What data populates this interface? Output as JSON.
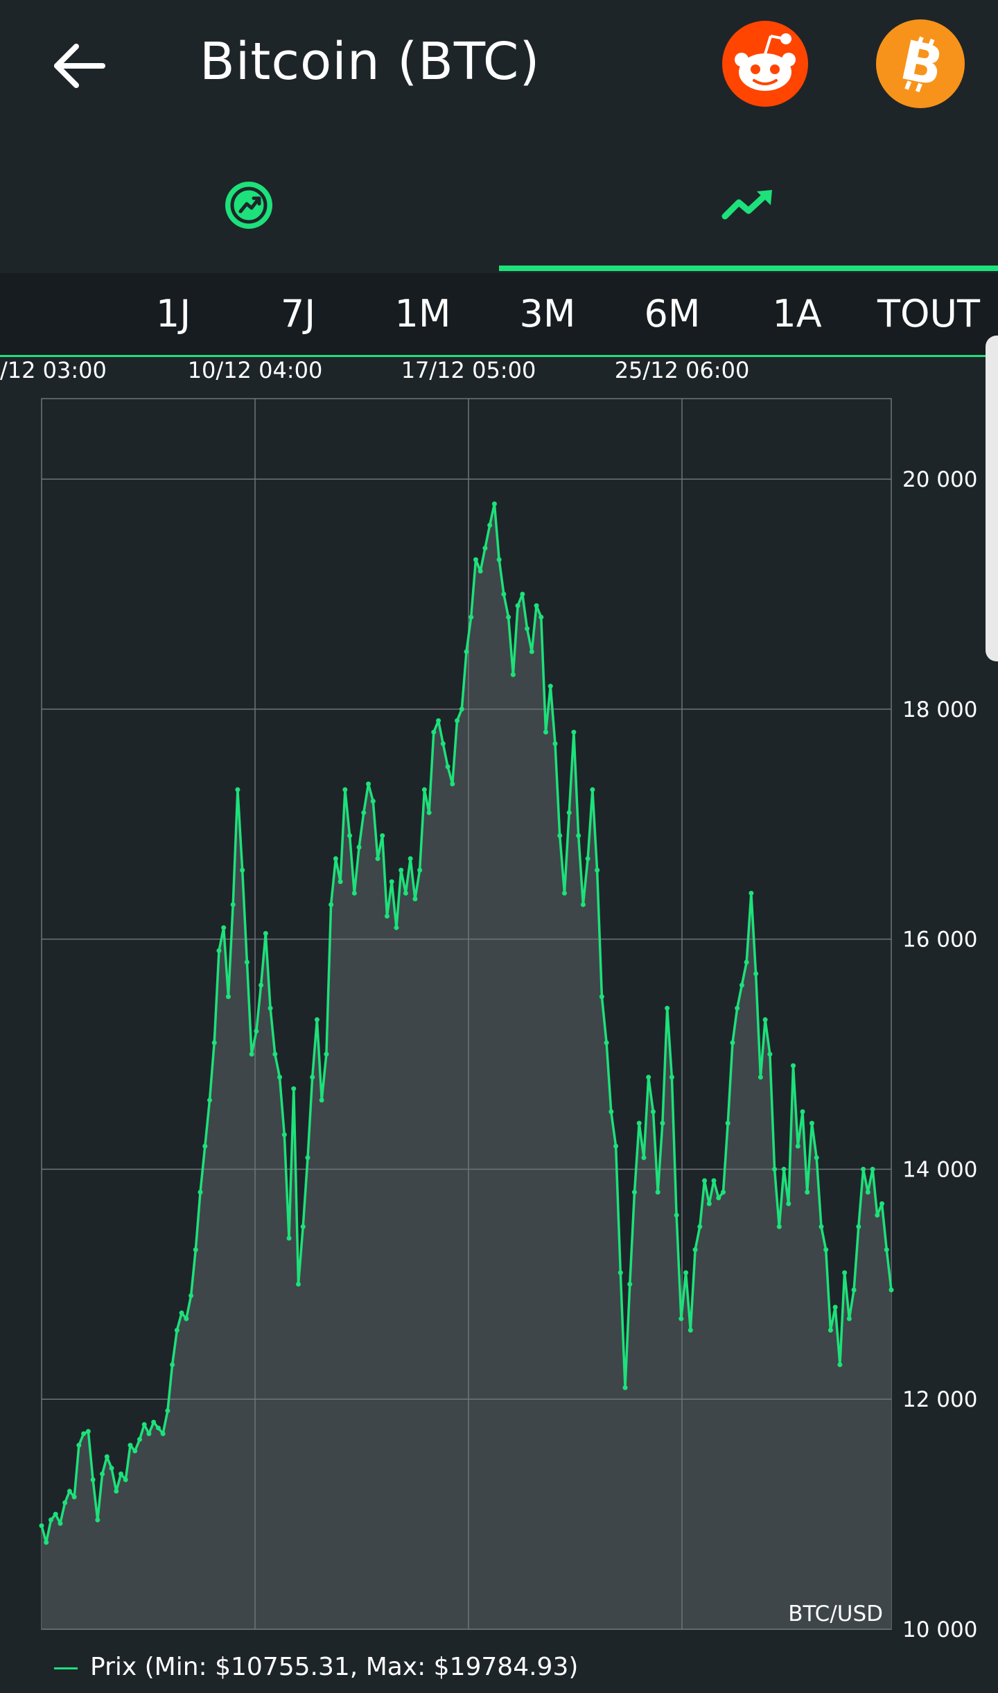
{
  "header": {
    "title": "Bitcoin (BTC)",
    "back_icon": "arrow-left-icon",
    "reddit_icon": "reddit-icon",
    "bitcoin_icon": "bitcoin-icon"
  },
  "tabs": [
    {
      "icon": "coin-chart-icon",
      "active": false
    },
    {
      "icon": "trending-up-icon",
      "active": true
    }
  ],
  "ranges": [
    "1J",
    "7J",
    "1M",
    "3M",
    "6M",
    "1A",
    "TOUT"
  ],
  "colors": {
    "background": "#1e2529",
    "accent": "#1de17a",
    "plot_fill": "#40484b",
    "grid": "#6e7578",
    "reddit": "#ff4500",
    "bitcoin": "#f7931a"
  },
  "chart_data": {
    "type": "line",
    "pair_label": "BTC/USD",
    "x_ticks": [
      "/12 03:00",
      "10/12 04:00",
      "17/12 05:00",
      "25/12 06:00"
    ],
    "y_ticks": [
      20000,
      18000,
      16000,
      14000,
      12000,
      10000
    ],
    "y_tick_labels": [
      "20 000",
      "18 000",
      "16 000",
      "14 000",
      "12 000",
      "10 000"
    ],
    "ylim": [
      10000,
      20700
    ],
    "grid": true,
    "legend": "bottom-left",
    "legend_label": "Prix (Min: $10755.31, Max: $19784.93)",
    "series": [
      {
        "values": [
          10900,
          10755,
          10950,
          11000,
          10920,
          11100,
          11200,
          11150,
          11600,
          11700,
          11720,
          11300,
          10950,
          11350,
          11500,
          11400,
          11200,
          11350,
          11300,
          11600,
          11550,
          11650,
          11780,
          11700,
          11800,
          11750,
          11700,
          11900,
          12300,
          12600,
          12750,
          12700,
          12900,
          13300,
          13800,
          14200,
          14600,
          15100,
          15900,
          16100,
          15500,
          16300,
          17300,
          16600,
          15800,
          15000,
          15200,
          15600,
          16050,
          15400,
          15000,
          14800,
          14300,
          13400,
          14700,
          13000,
          13500,
          14100,
          14800,
          15300,
          14600,
          15000,
          16300,
          16700,
          16500,
          17300,
          16900,
          16400,
          16800,
          17100,
          17350,
          17200,
          16700,
          16900,
          16200,
          16500,
          16100,
          16600,
          16400,
          16700,
          16350,
          16600,
          17300,
          17100,
          17800,
          17900,
          17700,
          17500,
          17350,
          17900,
          18000,
          18500,
          18800,
          19300,
          19200,
          19400,
          19600,
          19785,
          19300,
          19000,
          18800,
          18300,
          18900,
          19000,
          18700,
          18500,
          18900,
          18800,
          17800,
          18200,
          17700,
          16900,
          16400,
          17100,
          17800,
          16900,
          16300,
          16700,
          17300,
          16600,
          15500,
          15100,
          14500,
          14200,
          13100,
          12100,
          13000,
          13800,
          14400,
          14100,
          14800,
          14500,
          13800,
          14400,
          15400,
          14800,
          13600,
          12700,
          13100,
          12600,
          13300,
          13500,
          13900,
          13700,
          13900,
          13750,
          13800,
          14400,
          15100,
          15400,
          15600,
          15800,
          16400,
          15700,
          14800,
          15300,
          15000,
          14000,
          13500,
          14000,
          13700,
          14900,
          14200,
          14500,
          13800,
          14400,
          14100,
          13500,
          13300,
          12600,
          12800,
          12300,
          13100,
          12700,
          12950,
          13500,
          14000,
          13800,
          14000,
          13600,
          13700,
          13300,
          12950
        ]
      }
    ]
  }
}
